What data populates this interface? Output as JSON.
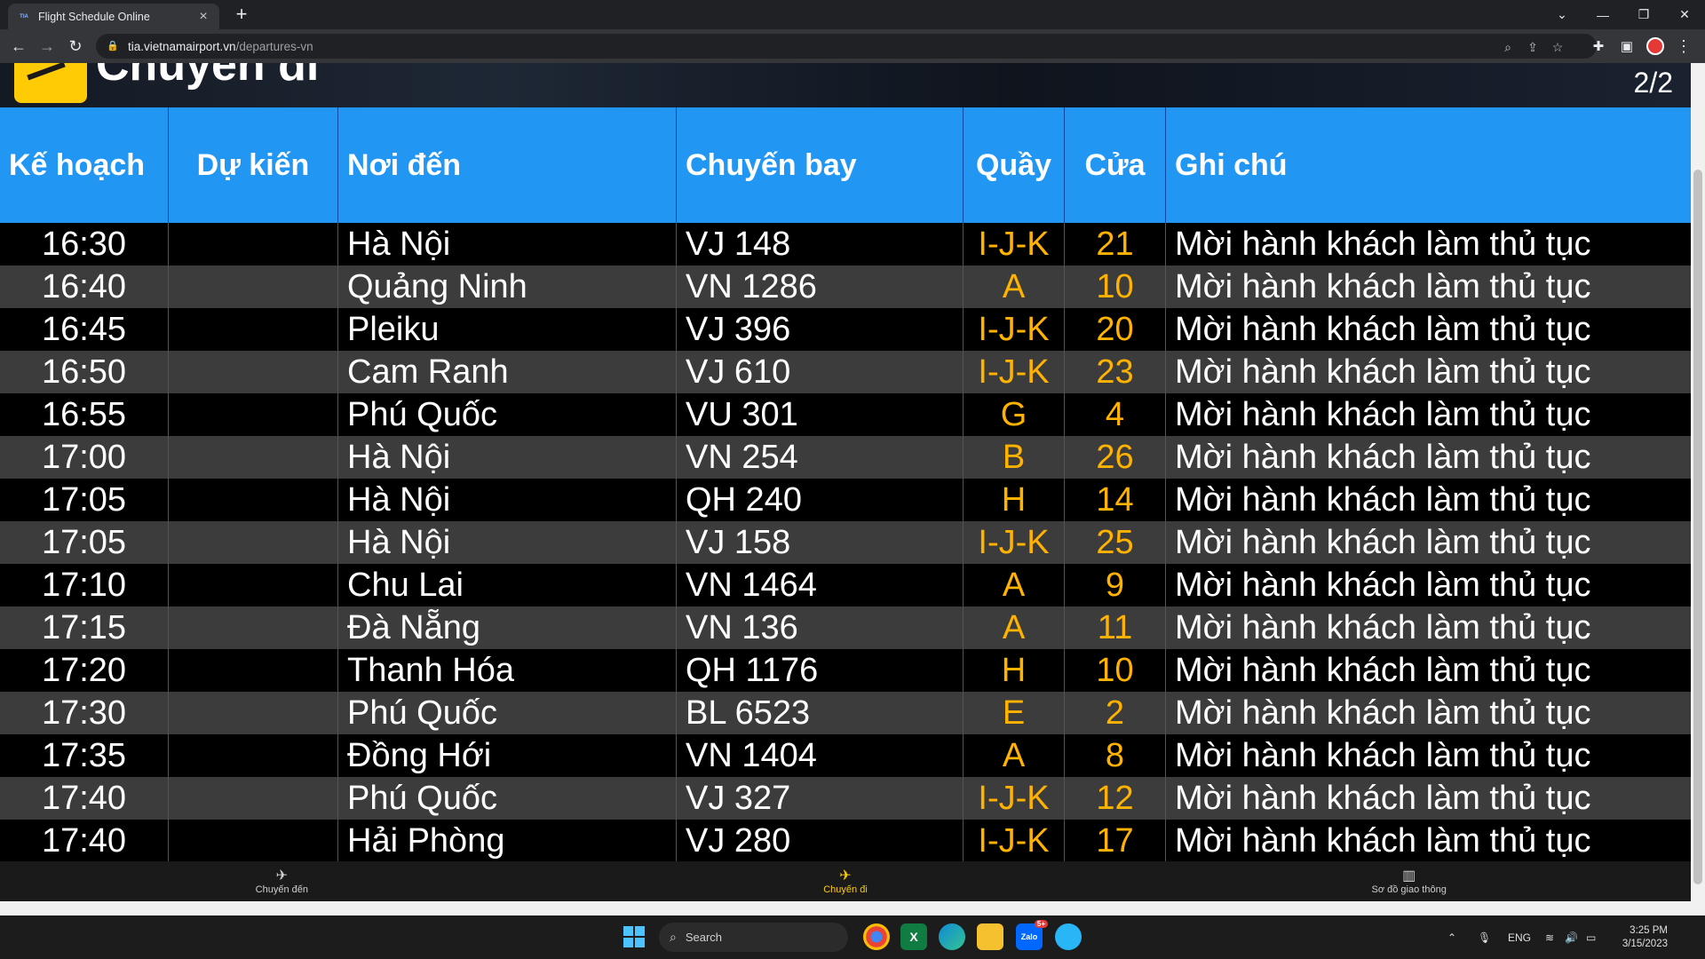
{
  "browser": {
    "tab_title": "Flight Schedule Online",
    "tab_favicon_text": "TIA",
    "url_host": "tia.vietnamairport.vn",
    "url_path": "/departures-vn"
  },
  "page": {
    "title": "Chuyến đi",
    "pager": "2/2",
    "columns": [
      "Kế hoạch",
      "Dự kiến",
      "Nơi đến",
      "Chuyến bay",
      "Quầy",
      "Cửa",
      "Ghi chú"
    ],
    "rows": [
      {
        "sched": "16:30",
        "est": "",
        "dest": "Hà Nội",
        "flight": "VJ 148",
        "counter": "I-J-K",
        "gate": "21",
        "note": "Mời hành khách làm thủ tục"
      },
      {
        "sched": "16:40",
        "est": "",
        "dest": "Quảng Ninh",
        "flight": "VN 1286",
        "counter": "A",
        "gate": "10",
        "note": "Mời hành khách làm thủ tục"
      },
      {
        "sched": "16:45",
        "est": "",
        "dest": "Pleiku",
        "flight": "VJ 396",
        "counter": "I-J-K",
        "gate": "20",
        "note": "Mời hành khách làm thủ tục"
      },
      {
        "sched": "16:50",
        "est": "",
        "dest": "Cam Ranh",
        "flight": "VJ 610",
        "counter": "I-J-K",
        "gate": "23",
        "note": "Mời hành khách làm thủ tục"
      },
      {
        "sched": "16:55",
        "est": "",
        "dest": "Phú Quốc",
        "flight": "VU 301",
        "counter": "G",
        "gate": "4",
        "note": "Mời hành khách làm thủ tục"
      },
      {
        "sched": "17:00",
        "est": "",
        "dest": "Hà Nội",
        "flight": "VN 254",
        "counter": "B",
        "gate": "26",
        "note": "Mời hành khách làm thủ tục"
      },
      {
        "sched": "17:05",
        "est": "",
        "dest": "Hà Nội",
        "flight": "QH 240",
        "counter": "H",
        "gate": "14",
        "note": "Mời hành khách làm thủ tục"
      },
      {
        "sched": "17:05",
        "est": "",
        "dest": "Hà Nội",
        "flight": "VJ 158",
        "counter": "I-J-K",
        "gate": "25",
        "note": "Mời hành khách làm thủ tục"
      },
      {
        "sched": "17:10",
        "est": "",
        "dest": "Chu Lai",
        "flight": "VN 1464",
        "counter": "A",
        "gate": "9",
        "note": "Mời hành khách làm thủ tục"
      },
      {
        "sched": "17:15",
        "est": "",
        "dest": "Đà Nẵng",
        "flight": "VN 136",
        "counter": "A",
        "gate": "11",
        "note": "Mời hành khách làm thủ tục"
      },
      {
        "sched": "17:20",
        "est": "",
        "dest": "Thanh Hóa",
        "flight": "QH 1176",
        "counter": "H",
        "gate": "10",
        "note": "Mời hành khách làm thủ tục"
      },
      {
        "sched": "17:30",
        "est": "",
        "dest": "Phú Quốc",
        "flight": "BL 6523",
        "counter": "E",
        "gate": "2",
        "note": "Mời hành khách làm thủ tục"
      },
      {
        "sched": "17:35",
        "est": "",
        "dest": "Đồng Hới",
        "flight": "VN 1404",
        "counter": "A",
        "gate": "8",
        "note": "Mời hành khách làm thủ tục"
      },
      {
        "sched": "17:40",
        "est": "",
        "dest": "Phú Quốc",
        "flight": "VJ 327",
        "counter": "I-J-K",
        "gate": "12",
        "note": "Mời hành khách làm thủ tục"
      },
      {
        "sched": "17:40",
        "est": "",
        "dest": "Hải Phòng",
        "flight": "VJ 280",
        "counter": "I-J-K",
        "gate": "17",
        "note": "Mời hành khách làm thủ tục"
      }
    ],
    "bottom_nav": [
      {
        "label": "Chuyến đến",
        "icon": "plane-landing-icon",
        "active": false
      },
      {
        "label": "Chuyến đi",
        "icon": "plane-takeoff-icon",
        "active": true
      },
      {
        "label": "Sơ đồ giao thông",
        "icon": "map-icon",
        "active": false
      }
    ]
  },
  "taskbar": {
    "search_label": "Search",
    "language": "ENG",
    "time": "3:25 PM",
    "date": "3/15/2023",
    "zalo_badge": "5+"
  },
  "colors": {
    "header_blue": "#2196f3",
    "highlight_yellow": "#ffb300",
    "brand_yellow": "#ffcb05"
  }
}
